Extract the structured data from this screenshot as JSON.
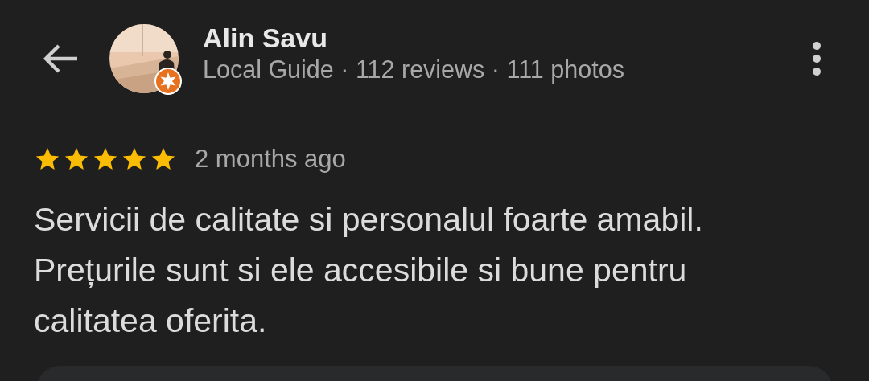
{
  "reviewer": {
    "name": "Alin Savu",
    "subtitle": "Local Guide · 112 reviews · 111 photos",
    "local_guide": true
  },
  "review": {
    "stars": 5,
    "time": "2 months ago",
    "text": "Servicii de calitate si personalul foarte amabil. Prețurile sunt si ele accesibile si bune pentru calitatea oferita."
  }
}
